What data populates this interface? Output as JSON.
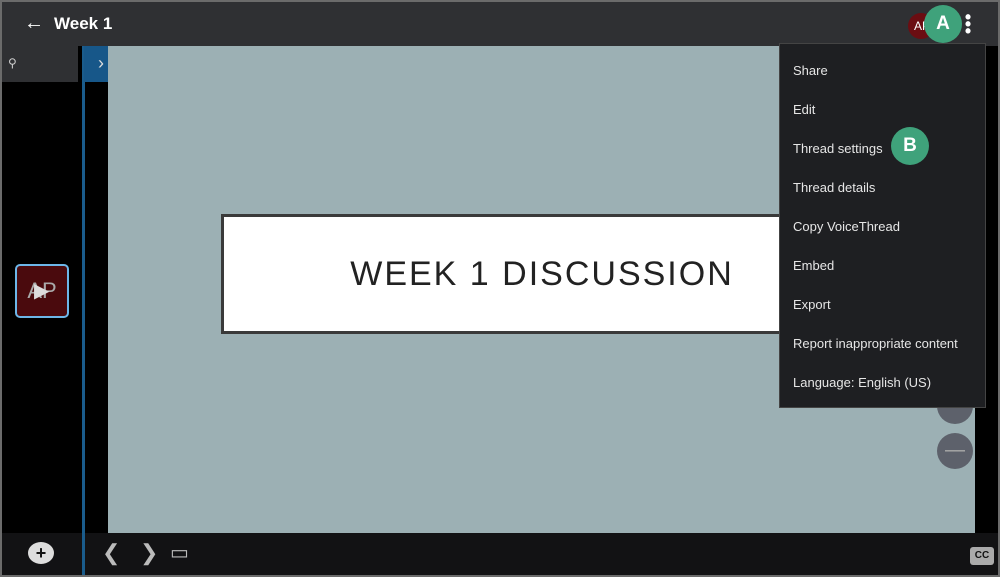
{
  "header": {
    "title": "Week 1",
    "avatar_initials": "AP"
  },
  "callouts": {
    "a": "A",
    "b": "B"
  },
  "slide": {
    "text": "WEEK 1 DISCUSSION",
    "thumbnail_initials": "AP"
  },
  "menu": {
    "items": [
      "Share",
      "Edit",
      "Thread settings",
      "Thread details",
      "Copy VoiceThread",
      "Embed",
      "Export",
      "Report inappropriate content",
      "Language: English (US)"
    ]
  },
  "bottom": {
    "cc_label": "CC"
  },
  "colors": {
    "header": "#2f3033",
    "slide_bg": "#9cb0b4",
    "callout": "#3fa27b",
    "accent_blue": "#175789"
  }
}
